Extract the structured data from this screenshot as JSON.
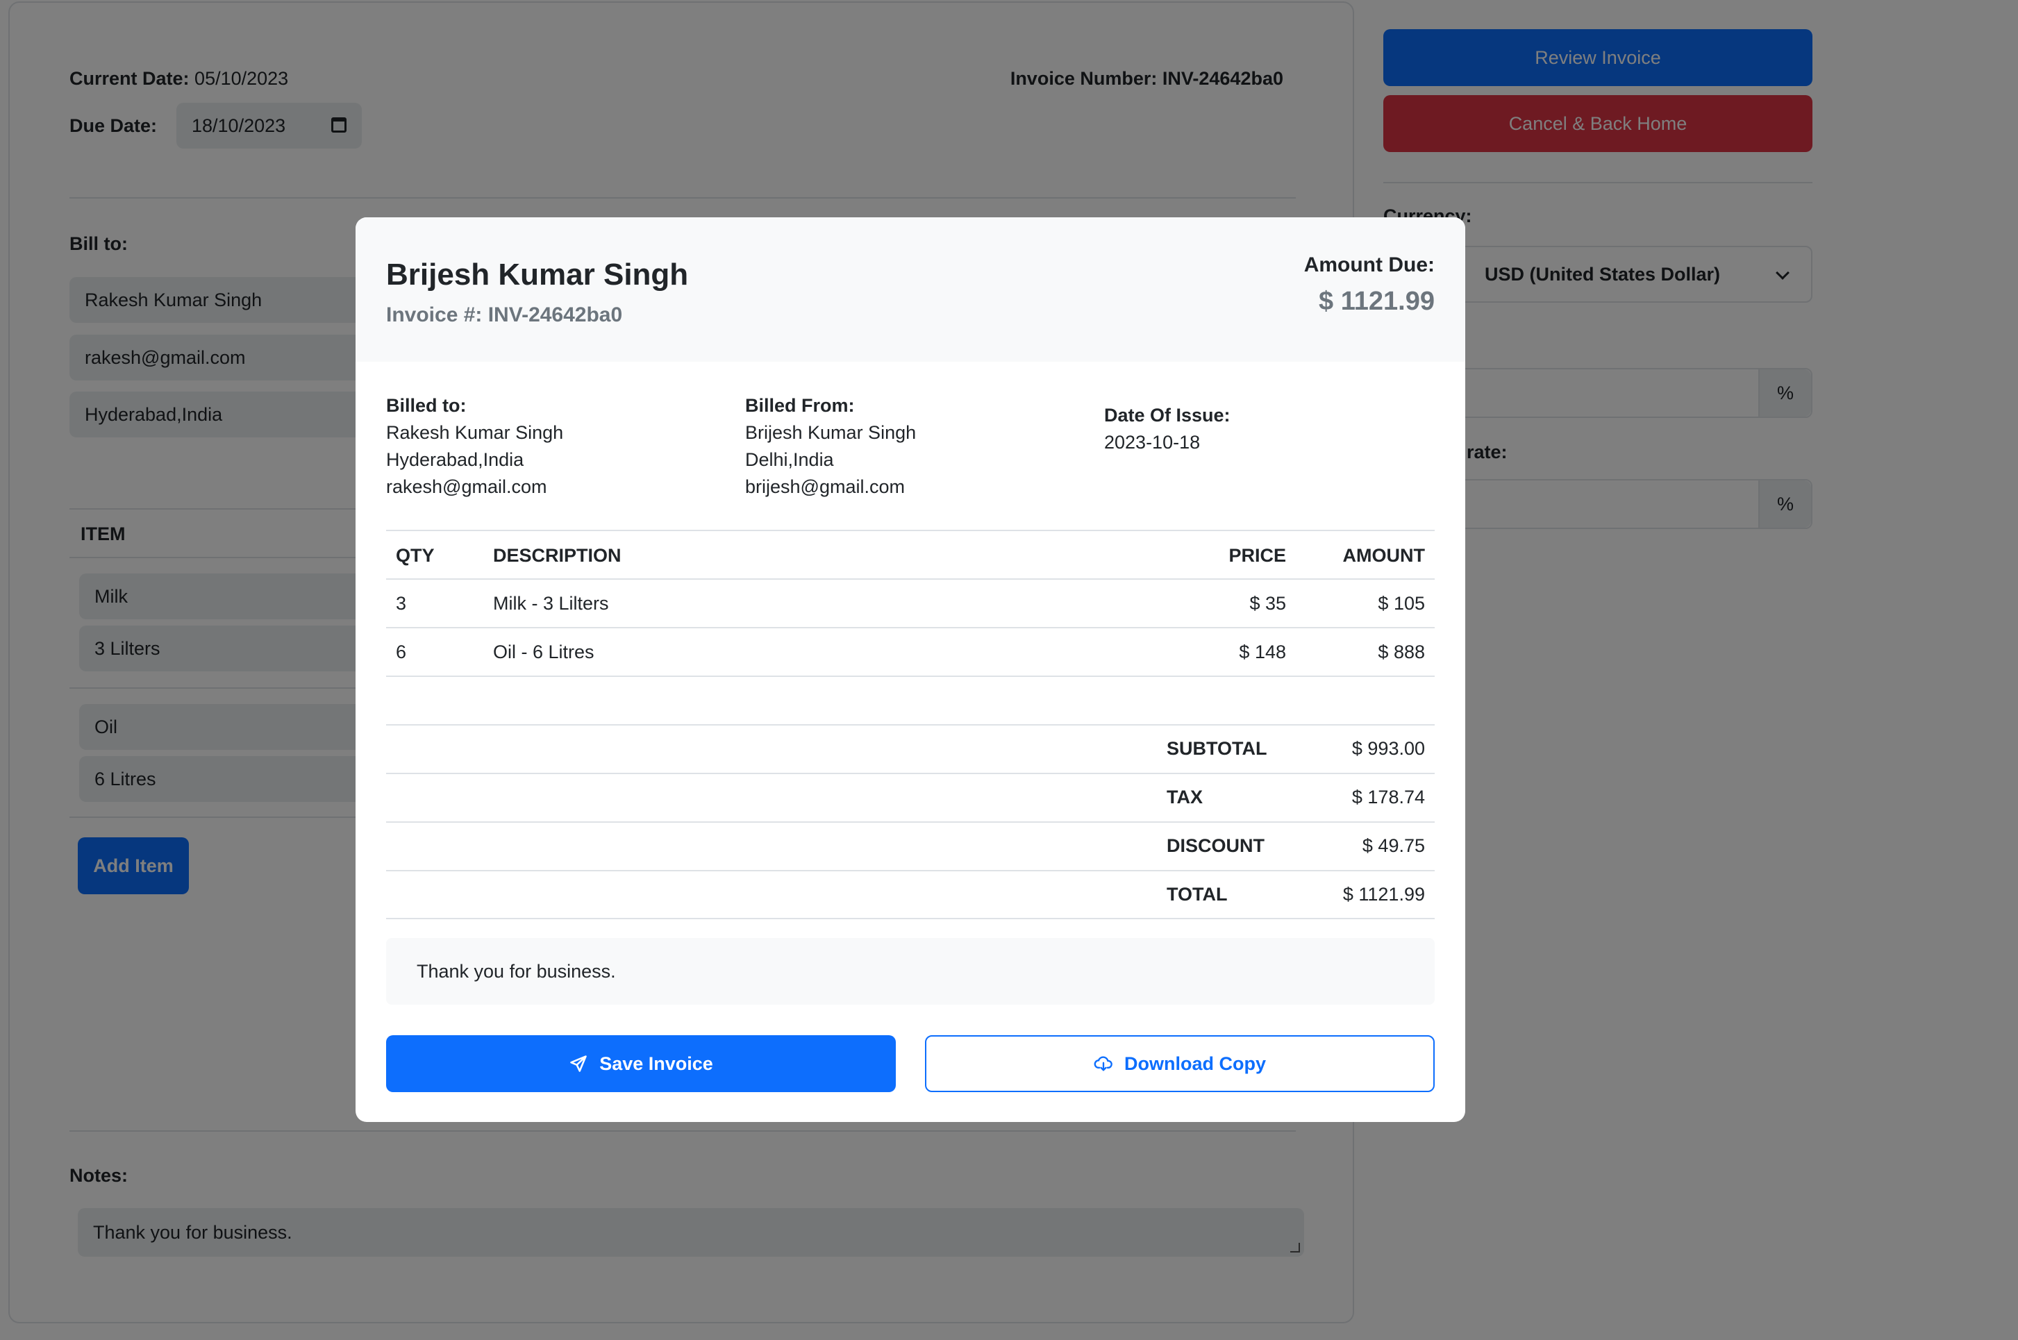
{
  "form": {
    "current_date_label": "Current Date:",
    "current_date": "05/10/2023",
    "invoice_number_label": "Invoice Number:",
    "invoice_number": "INV-24642ba0",
    "due_date_label": "Due Date:",
    "due_date": "18/10/2023",
    "bill_to_label": "Bill to:",
    "bill_to_name": "Rakesh Kumar Singh",
    "bill_to_email": "rakesh@gmail.com",
    "bill_to_address": "Hyderabad,India",
    "item_header": "ITEM",
    "items": [
      {
        "name": "Milk",
        "description": "3 Lilters"
      },
      {
        "name": "Oil",
        "description": "6 Litres"
      }
    ],
    "add_item_label": "Add Item",
    "notes_label": "Notes:",
    "notes_value": "Thank you for business."
  },
  "sidebar": {
    "review_label": "Review Invoice",
    "cancel_label": "Cancel & Back Home",
    "currency_label": "Currency:",
    "currency_value": "USD (United States Dollar)",
    "rate_label": "rate:",
    "percent_symbol": "%"
  },
  "modal": {
    "name": "Brijesh Kumar Singh",
    "invoice_label": "Invoice #: INV-24642ba0",
    "amount_due_label": "Amount Due:",
    "amount_due": "$ 1121.99",
    "billed_to_label": "Billed to:",
    "billed_to": [
      "Rakesh Kumar Singh",
      "Hyderabad,India",
      "rakesh@gmail.com"
    ],
    "billed_from_label": "Billed From:",
    "billed_from": [
      "Brijesh Kumar Singh",
      "Delhi,India",
      "brijesh@gmail.com"
    ],
    "date_issue_label": "Date Of Issue:",
    "date_issue": "2023-10-18",
    "table": {
      "headers": [
        "QTY",
        "DESCRIPTION",
        "PRICE",
        "AMOUNT"
      ],
      "rows": [
        [
          "3",
          "Milk - 3 Lilters",
          "$ 35",
          "$ 105"
        ],
        [
          "6",
          "Oil - 6 Litres",
          "$ 148",
          "$ 888"
        ]
      ]
    },
    "totals": [
      {
        "label": "SUBTOTAL",
        "value": "$ 993.00"
      },
      {
        "label": "TAX",
        "value": "$ 178.74"
      },
      {
        "label": "DISCOUNT",
        "value": "$ 49.75"
      },
      {
        "label": "TOTAL",
        "value": "$ 1121.99"
      }
    ],
    "note": "Thank you for business.",
    "save_label": "Save Invoice",
    "download_label": "Download Copy"
  },
  "colors": {
    "primary": "#0d6efd",
    "danger": "#dc3545",
    "overlay": "rgba(0,0,0,0.5)"
  }
}
